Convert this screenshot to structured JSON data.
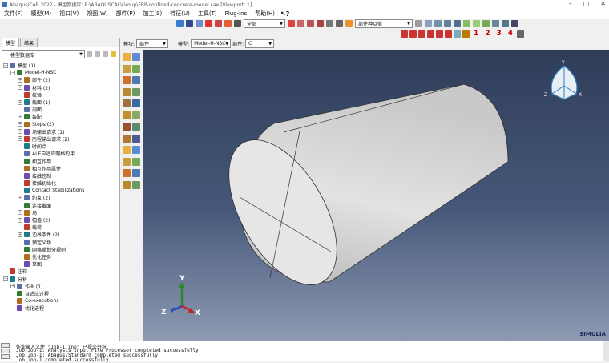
{
  "window": {
    "title": "Abaqus/CAE 2022 - 模型数据库: E:\\ABAQUSCAL\\Group\\FRP-confined-concrete-model.cae [Viewport: 1]"
  },
  "menu": [
    "文件(F)",
    "模型(M)",
    "视口(V)",
    "视图(W)",
    "部件(P)",
    "加工(S)",
    "特征(U)",
    "工具(T)",
    "Plug-ins",
    "帮助(H)"
  ],
  "toolbar": {
    "filter_selected": "全部",
    "render_style": "部件种以值",
    "view_numbers": [
      "1",
      "2",
      "3",
      "4"
    ]
  },
  "context": {
    "module_label": "模块:",
    "module_value": "部件",
    "model_label": "模型:",
    "model_value": "Model-H-NSC",
    "part_label": "部件:",
    "part_value": "C"
  },
  "left_panel": {
    "tabs": [
      "模型",
      "结果"
    ],
    "active_tab": "模型",
    "tree_combo": "模型数据库"
  },
  "tree": [
    {
      "label": "模型 (1)",
      "level": 0,
      "exp": "−"
    },
    {
      "label": "Model-H-NSC",
      "level": 1,
      "exp": "−"
    },
    {
      "label": "部件 (2)",
      "level": 2,
      "exp": "+"
    },
    {
      "label": "材料 (2)",
      "level": 2,
      "exp": "+"
    },
    {
      "label": "校验",
      "level": 2,
      "exp": ""
    },
    {
      "label": "截面 (1)",
      "level": 2,
      "exp": "+"
    },
    {
      "label": "剖面",
      "level": 2,
      "exp": ""
    },
    {
      "label": "装配",
      "level": 2,
      "exp": "+"
    },
    {
      "label": "Steps (2)",
      "level": 2,
      "exp": "+"
    },
    {
      "label": "场输出请求 (1)",
      "level": 2,
      "exp": "+"
    },
    {
      "label": "历程输出请求 (2)",
      "level": 2,
      "exp": "+"
    },
    {
      "label": "时间点",
      "level": 2,
      "exp": ""
    },
    {
      "label": "ALE自适应网格约束",
      "level": 2,
      "exp": ""
    },
    {
      "label": "相互作用",
      "level": 2,
      "exp": ""
    },
    {
      "label": "相互作用属性",
      "level": 2,
      "exp": ""
    },
    {
      "label": "接触控制",
      "level": 2,
      "exp": ""
    },
    {
      "label": "接触初始化",
      "level": 2,
      "exp": ""
    },
    {
      "label": "Contact Stabilizations",
      "level": 2,
      "exp": ""
    },
    {
      "label": "约束 (2)",
      "level": 2,
      "exp": "+"
    },
    {
      "label": "连接截面",
      "level": 2,
      "exp": ""
    },
    {
      "label": "场",
      "level": 2,
      "exp": "+"
    },
    {
      "label": "幅值 (2)",
      "level": 2,
      "exp": "+"
    },
    {
      "label": "载荷",
      "level": 2,
      "exp": ""
    },
    {
      "label": "边界条件 (2)",
      "level": 2,
      "exp": "+"
    },
    {
      "label": "预定义场",
      "level": 2,
      "exp": ""
    },
    {
      "label": "网格重划分规则",
      "level": 2,
      "exp": ""
    },
    {
      "label": "优化任务",
      "level": 2,
      "exp": ""
    },
    {
      "label": "草图",
      "level": 2,
      "exp": ""
    },
    {
      "label": "注释",
      "level": 0,
      "exp": ""
    },
    {
      "label": "分析",
      "level": 0,
      "exp": "−"
    },
    {
      "label": "作业 (1)",
      "level": 1,
      "exp": "+"
    },
    {
      "label": "自适应过程",
      "level": 1,
      "exp": ""
    },
    {
      "label": "Co-executions",
      "level": 1,
      "exp": ""
    },
    {
      "label": "优化进程",
      "level": 1,
      "exp": ""
    }
  ],
  "viewport": {
    "triad_labels": {
      "y": "Y",
      "z": "Z",
      "x": "X"
    },
    "brand": "SIMULIA"
  },
  "messages": [
    "作业输入文件 \"Job-1.inp\" 已提交分析",
    "Job Job-1: Analysis Input File Processor completed successfully.",
    "Job Job-1: Abaqus/Standard completed successfully",
    "Job Job-1 completed successfully."
  ],
  "colors": {
    "viewport_top": "#2f3d58",
    "viewport_bottom": "#8e9ab2",
    "view_number": "#cc0000"
  }
}
